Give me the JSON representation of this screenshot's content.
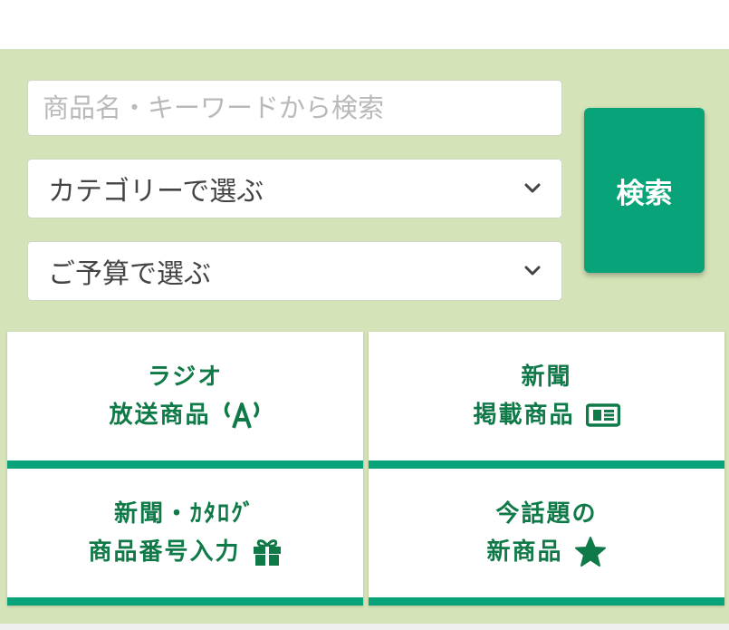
{
  "search": {
    "keyword_placeholder": "商品名・キーワードから検索",
    "keyword_value": "",
    "category_select": "カテゴリーで選ぶ",
    "budget_select": "ご予算で選ぶ",
    "submit_label": "検索"
  },
  "tiles": [
    {
      "line1": "ラジオ",
      "line2": "放送商品",
      "icon": "radio-antenna-icon"
    },
    {
      "line1": "新聞",
      "line2": "掲載商品",
      "icon": "newspaper-icon"
    },
    {
      "line1": "新聞・ｶﾀﾛｸﾞ",
      "line2": "商品番号入力",
      "icon": "gift-icon"
    },
    {
      "line1": "今話題の",
      "line2": "新商品",
      "icon": "star-icon"
    }
  ],
  "colors": {
    "panel_bg": "#d5e3b8",
    "accent": "#08a378",
    "tile_text": "#0f7a48"
  }
}
